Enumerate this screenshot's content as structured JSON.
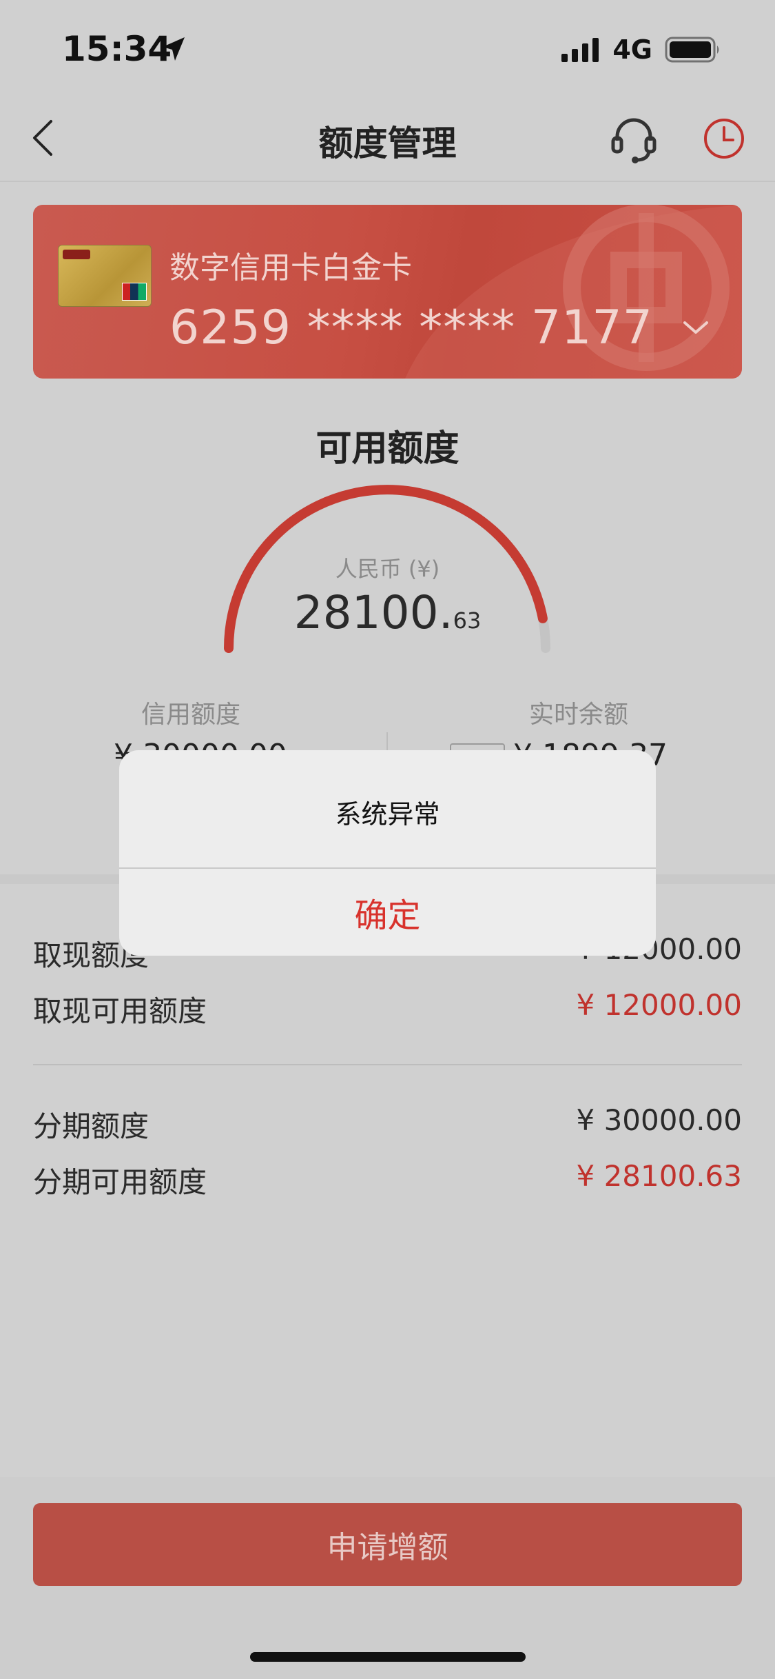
{
  "status_bar": {
    "time": "15:34",
    "network": "4G"
  },
  "nav": {
    "title": "额度管理"
  },
  "card": {
    "name": "数字信用卡白金卡",
    "number": "6259 **** **** 7177"
  },
  "available": {
    "title": "可用额度",
    "currency": "人民币 (¥)",
    "amount_int": "28100.",
    "amount_dec": "63",
    "gauge_fraction": 0.94
  },
  "summary": {
    "credit_label": "信用额度",
    "credit_value": "¥ 30000.00",
    "balance_label": "实时余额",
    "balance_value": "¥ 1899.37"
  },
  "cash": {
    "limit_label": "取现额度",
    "limit_value": "¥ 12000.00",
    "available_label": "取现可用额度",
    "available_value": "¥ 12000.00"
  },
  "installment": {
    "limit_label": "分期额度",
    "limit_value": "¥ 30000.00",
    "available_label": "分期可用额度",
    "available_value": "¥ 28100.63"
  },
  "footer": {
    "apply_label": "申请增额"
  },
  "alert": {
    "message": "系统异常",
    "confirm_label": "确定"
  },
  "colors": {
    "accent": "#c0322d",
    "card": "#c74f43"
  }
}
